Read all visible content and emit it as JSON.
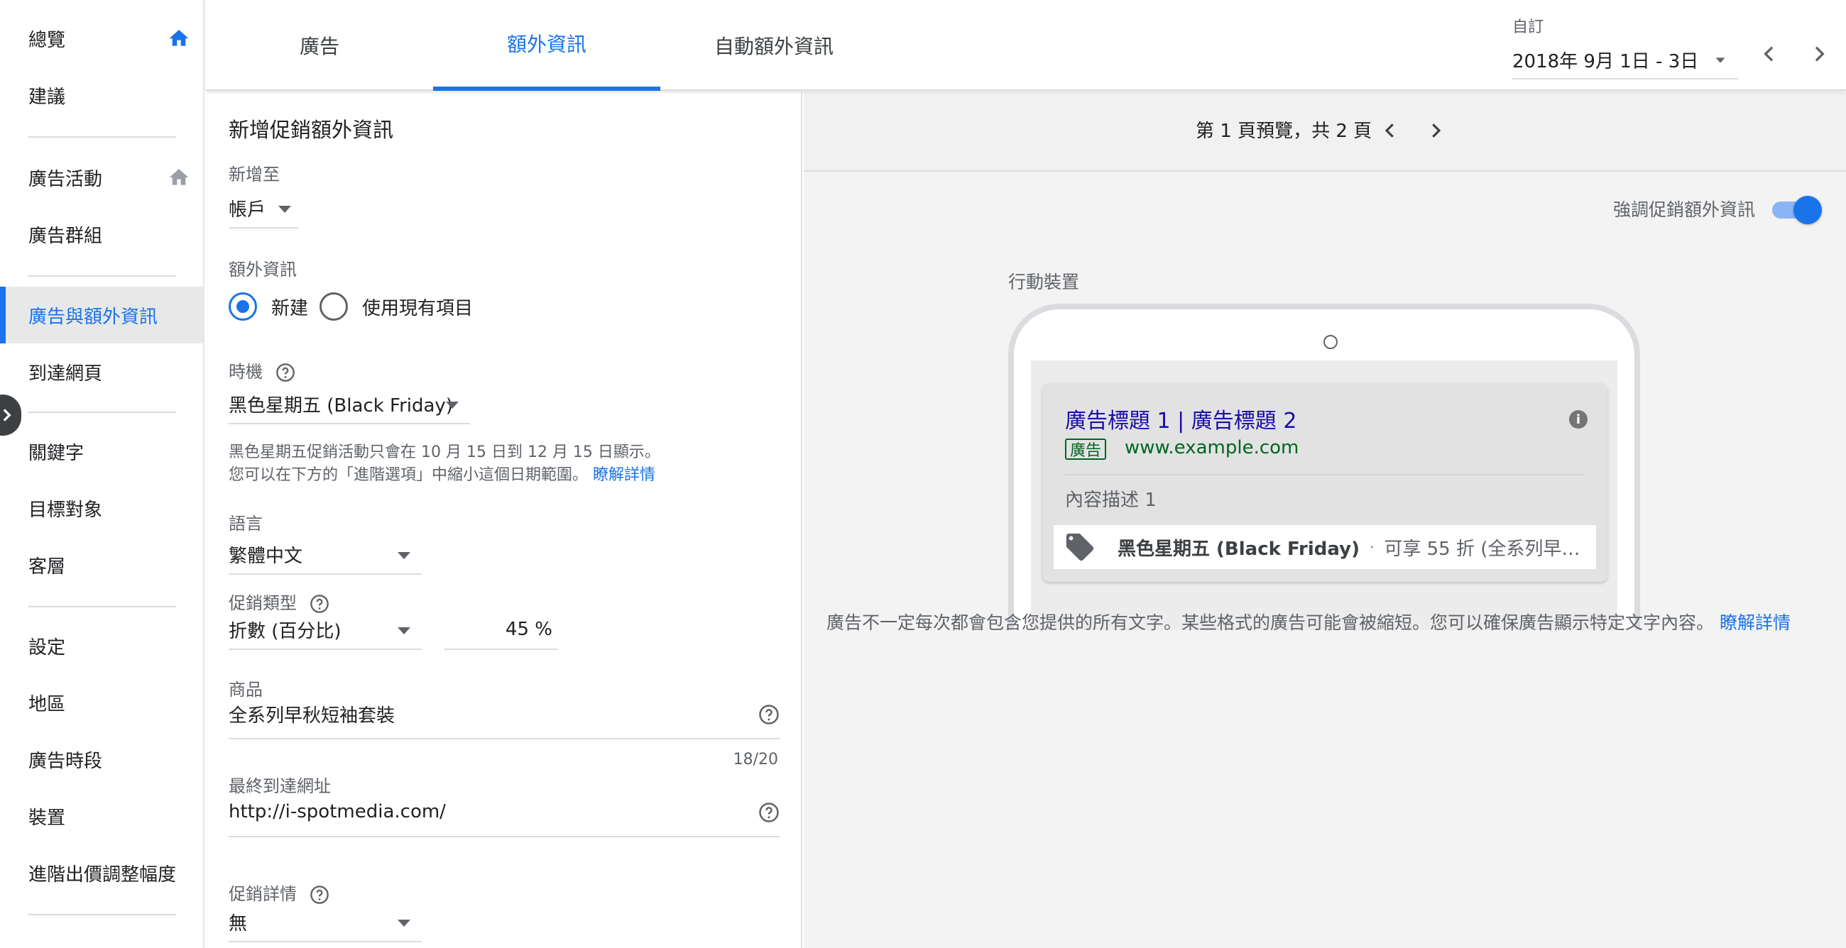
{
  "sidebar": {
    "items": [
      {
        "label": "總覽"
      },
      {
        "label": "建議"
      },
      {
        "label": "廣告活動"
      },
      {
        "label": "廣告群組"
      },
      {
        "label": "廣告與額外資訊"
      },
      {
        "label": "到達網頁"
      },
      {
        "label": "關鍵字"
      },
      {
        "label": "目標對象"
      },
      {
        "label": "客層"
      },
      {
        "label": "設定"
      },
      {
        "label": "地區"
      },
      {
        "label": "廣告時段"
      },
      {
        "label": "裝置"
      },
      {
        "label": "進階出價調整幅度"
      }
    ],
    "active_item": "廣告與額外資訊"
  },
  "tabs": [
    {
      "label": "廣告"
    },
    {
      "label": "額外資訊"
    },
    {
      "label": "自動額外資訊"
    }
  ],
  "date_range": {
    "label": "自訂",
    "value": "2018年 9月 1日 - 3日"
  },
  "form": {
    "title": "新增促銷額外資訊",
    "add_to": {
      "label": "新增至",
      "value": "帳戶"
    },
    "extension": {
      "label": "額外資訊",
      "option_new": "新建",
      "option_existing": "使用現有項目",
      "selected": "新建"
    },
    "occasion": {
      "label": "時機",
      "value": "黑色星期五 (Black Friday)"
    },
    "occasion_hint": {
      "line1": "黑色星期五促銷活動只會在 10 月 15 日到 12 月 15 日顯示。",
      "line2": "您可以在下方的「進階選項」中縮小這個日期範圍。",
      "link": "瞭解詳情"
    },
    "language": {
      "label": "語言",
      "value": "繁體中文"
    },
    "promo_type": {
      "label": "促銷類型",
      "value": "折數 (百分比)",
      "amount": "45",
      "unit": "%"
    },
    "item": {
      "label": "商品",
      "value": "全系列早秋短袖套裝",
      "counter": "18/20"
    },
    "final_url": {
      "label": "最終到達網址",
      "value": "http://i-spotmedia.com/"
    },
    "promo_details": {
      "label": "促銷詳情",
      "value": "無"
    }
  },
  "preview": {
    "pager": "第 1 頁預覽，共 2 頁",
    "toggle_label": "強調促銷額外資訊",
    "toggle_on": true,
    "device_label": "行動裝置",
    "ad": {
      "headline": "廣告標題 1 | 廣告標題 2",
      "badge": "廣告",
      "url": "www.example.com",
      "description": "內容描述 1",
      "promo_occasion": "黑色星期五 (Black Friday)",
      "promo_text": "可享 55 折 (全系列早…",
      "info_icon": "i"
    },
    "disclaimer": "廣告不一定每次都會包含您提供的所有文字。某些格式的廣告可能會被縮短。您可以確保廣告顯示特定文字內容。",
    "disclaimer_link": "瞭解詳情"
  },
  "colors": {
    "accent": "#1a73e8",
    "ad_green": "#006621",
    "ad_title": "#1a0dab"
  },
  "icons": {
    "home": "home-icon",
    "chevron_left": "chevron-left-icon",
    "chevron_right": "chevron-right-icon",
    "dropdown": "caret-down-icon",
    "help": "help-circle-icon",
    "tag": "tag-icon",
    "info": "info-icon"
  }
}
